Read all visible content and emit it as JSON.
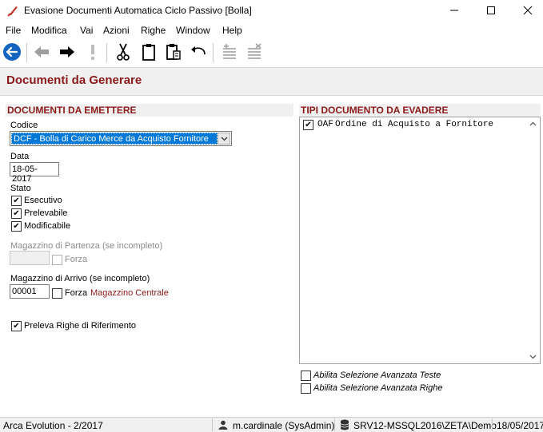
{
  "window": {
    "title": "Evasione Documenti Automatica Ciclo Passivo [Bolla]",
    "minimize_icon": "minimize-icon",
    "maximize_icon": "maximize-icon",
    "close_icon": "close-icon"
  },
  "menu": {
    "items": [
      "File",
      "Modifica",
      "Vai",
      "Azioni",
      "Righe",
      "Window",
      "Help"
    ]
  },
  "toolbar": {
    "icons": [
      "back-circle-icon",
      "arrow-left-icon",
      "arrow-right-icon",
      "exclamation-icon",
      "cut-icon",
      "clipboard-icon",
      "paste-icon",
      "undo-icon",
      "insert-row-icon",
      "delete-row-icon"
    ]
  },
  "header": {
    "title": "Documenti da Generare"
  },
  "left": {
    "section_title": "DOCUMENTI DA EMETTERE",
    "codice_label": "Codice",
    "codice_value": "DCF - Bolla di Carico Merce da Acquisto Fornitore",
    "data_label": "Data",
    "data_value": "18-05-2017",
    "stato_label": "Stato",
    "stato": [
      {
        "label": "Esecutivo",
        "checked": true
      },
      {
        "label": "Prelevabile",
        "checked": true
      },
      {
        "label": "Modificabile",
        "checked": true
      }
    ],
    "mag_partenza_label": "Magazzino di Partenza (se incompleto)",
    "mag_partenza_value": "",
    "forza_label": "Forza",
    "mag_arrivo_label": "Magazzino di Arrivo (se incompleto)",
    "mag_arrivo_value": "00001",
    "mag_arrivo_name": "Magazzino Centrale",
    "preleva_label": "Preleva Righe di Riferimento",
    "preleva_checked": true
  },
  "right": {
    "section_title": "TIPI DOCUMENTO DA EVADERE",
    "items": [
      {
        "code": "OAF",
        "description": "Ordine di Acquisto a Fornitore",
        "checked": true
      }
    ],
    "abilita_teste": "Abilita Selezione Avanzata Teste",
    "abilita_righe": "Abilita Selezione Avanzata Righe"
  },
  "status": {
    "app": "Arca Evolution - 2/2017",
    "user": "m.cardinale (SysAdmin)",
    "db": "SRV12-MSSQL2016\\ZETA\\Demo",
    "date": "18/05/2017"
  },
  "colors": {
    "accent": "#8b1a1a",
    "selection": "#0078d7",
    "header_bg": "#f0f0f0"
  }
}
